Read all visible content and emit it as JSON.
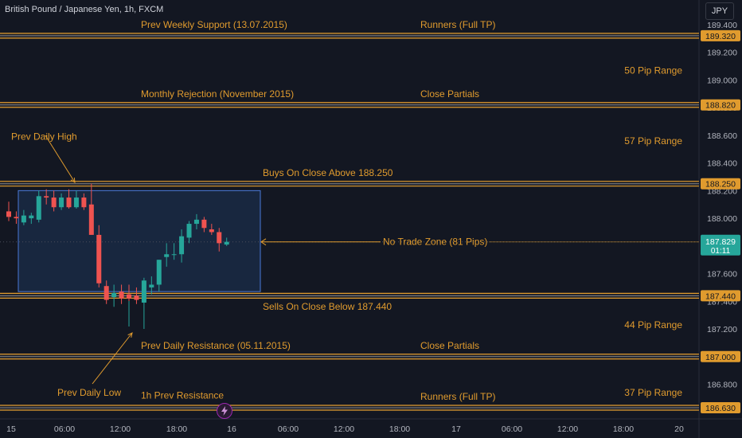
{
  "header": {
    "symbol_title": "British Pound / Japanese Yen, 1h, FXCM",
    "currency": "JPY"
  },
  "colors": {
    "background": "#131722",
    "level_line": "#e09b2e",
    "annotation_text": "#e09b2e",
    "bull": "#26a69a",
    "bear": "#ef5350",
    "zone_fill": "#1a2a44",
    "zone_border": "#2962ff",
    "axis_text": "#b2b5be"
  },
  "chart_data": {
    "type": "candlestick",
    "title": "British Pound / Japanese Yen, 1h, FXCM",
    "ylim": [
      186.55,
      189.45
    ],
    "y_ticks": [
      "186.800",
      "187.000",
      "187.200",
      "187.400",
      "187.600",
      "187.800",
      "188.000",
      "188.200",
      "188.400",
      "188.600",
      "188.800",
      "189.000",
      "189.200",
      "189.400"
    ],
    "x_ticks": [
      "15",
      "06:00",
      "12:00",
      "18:00",
      "16",
      "06:00",
      "12:00",
      "18:00",
      "17",
      "06:00",
      "12:00",
      "18:00",
      "20"
    ],
    "price_labels": [
      {
        "value": "189.320",
        "price": 189.32
      },
      {
        "value": "188.820",
        "price": 188.82
      },
      {
        "value": "188.250",
        "price": 188.25
      },
      {
        "value": "187.440",
        "price": 187.44
      },
      {
        "value": "187.000",
        "price": 187.0
      },
      {
        "value": "186.630",
        "price": 186.63
      }
    ],
    "current_price": {
      "value": "187.829",
      "countdown": "01:11",
      "price": 187.829
    },
    "levels": [
      {
        "price": 189.32
      },
      {
        "price": 188.82
      },
      {
        "price": 188.25
      },
      {
        "price": 187.44
      },
      {
        "price": 187.0
      },
      {
        "price": 186.63
      }
    ],
    "annotations": [
      {
        "text": "Prev Weekly Support (13.07.2015)",
        "price": 189.4,
        "col": "left"
      },
      {
        "text": "Runners (Full TP)",
        "price": 189.4,
        "col": "mid"
      },
      {
        "text": "50 Pip Range",
        "price": 189.07,
        "col": "right"
      },
      {
        "text": "Monthly Rejection (November 2015)",
        "price": 188.9,
        "col": "left"
      },
      {
        "text": "Close Partials",
        "price": 188.9,
        "col": "mid"
      },
      {
        "text": "Prev Daily High",
        "price": 188.59,
        "col": "far"
      },
      {
        "text": "57 Pip Range",
        "price": 188.56,
        "col": "right"
      },
      {
        "text": "Buys On Close Above 188.250",
        "price": 188.33,
        "col": "mid2"
      },
      {
        "text": "No Trade Zone (81 Pips)",
        "price": 187.83,
        "col": "nz"
      },
      {
        "text": "Sells On Close Below 187.440",
        "price": 187.36,
        "col": "mid2"
      },
      {
        "text": "44 Pip Range",
        "price": 187.23,
        "col": "right"
      },
      {
        "text": "Prev Daily Resistance (05.11.2015)",
        "price": 187.08,
        "col": "left"
      },
      {
        "text": "Close Partials",
        "price": 187.08,
        "col": "mid"
      },
      {
        "text": "Prev Daily Low",
        "price": 186.74,
        "col": "far2"
      },
      {
        "text": "37 Pip Range",
        "price": 186.74,
        "col": "right"
      },
      {
        "text": "1h Prev Resistance",
        "price": 186.72,
        "col": "left"
      },
      {
        "text": "Runners (Full TP)",
        "price": 186.71,
        "col": "mid"
      }
    ],
    "zone": {
      "label": "No Trade Zone (81 Pips)",
      "top": 188.2,
      "bottom": 187.47
    },
    "candles": [
      {
        "o": 188.05,
        "h": 188.12,
        "l": 187.98,
        "c": 188.01
      },
      {
        "o": 188.01,
        "h": 188.05,
        "l": 187.96,
        "c": 188.0
      },
      {
        "o": 187.97,
        "h": 188.06,
        "l": 187.95,
        "c": 188.02
      },
      {
        "o": 188.0,
        "h": 188.04,
        "l": 187.96,
        "c": 188.02
      },
      {
        "o": 187.99,
        "h": 188.2,
        "l": 187.97,
        "c": 188.16
      },
      {
        "o": 188.16,
        "h": 188.21,
        "l": 188.1,
        "c": 188.15
      },
      {
        "o": 188.15,
        "h": 188.2,
        "l": 188.05,
        "c": 188.08
      },
      {
        "o": 188.08,
        "h": 188.18,
        "l": 188.06,
        "c": 188.15
      },
      {
        "o": 188.15,
        "h": 188.21,
        "l": 188.07,
        "c": 188.08
      },
      {
        "o": 188.08,
        "h": 188.2,
        "l": 188.07,
        "c": 188.15
      },
      {
        "o": 188.15,
        "h": 188.18,
        "l": 188.06,
        "c": 188.08
      },
      {
        "o": 188.1,
        "h": 188.25,
        "l": 187.95,
        "c": 187.88
      },
      {
        "o": 187.88,
        "h": 187.95,
        "l": 187.5,
        "c": 187.53
      },
      {
        "o": 187.51,
        "h": 187.55,
        "l": 187.38,
        "c": 187.41
      },
      {
        "o": 187.43,
        "h": 187.52,
        "l": 187.36,
        "c": 187.46
      },
      {
        "o": 187.47,
        "h": 187.52,
        "l": 187.38,
        "c": 187.42
      },
      {
        "o": 187.45,
        "h": 187.52,
        "l": 187.4,
        "c": 187.42
      },
      {
        "o": 187.44,
        "h": 187.5,
        "l": 187.38,
        "c": 187.41
      },
      {
        "o": 187.39,
        "h": 187.57,
        "l": 187.2,
        "c": 187.55
      },
      {
        "o": 187.5,
        "h": 187.58,
        "l": 187.45,
        "c": 187.52
      },
      {
        "o": 187.52,
        "h": 187.7,
        "l": 187.47,
        "c": 187.7
      },
      {
        "o": 187.72,
        "h": 187.82,
        "l": 187.65,
        "c": 187.74
      },
      {
        "o": 187.74,
        "h": 187.82,
        "l": 187.7,
        "c": 187.74
      },
      {
        "o": 187.74,
        "h": 187.92,
        "l": 187.68,
        "c": 187.87
      },
      {
        "o": 187.86,
        "h": 187.98,
        "l": 187.82,
        "c": 187.96
      },
      {
        "o": 187.96,
        "h": 188.03,
        "l": 187.92,
        "c": 187.99
      },
      {
        "o": 187.99,
        "h": 188.01,
        "l": 187.9,
        "c": 187.93
      },
      {
        "o": 187.92,
        "h": 187.96,
        "l": 187.88,
        "c": 187.9
      },
      {
        "o": 187.9,
        "h": 187.93,
        "l": 187.76,
        "c": 187.82
      },
      {
        "o": 187.81,
        "h": 187.86,
        "l": 187.8,
        "c": 187.83
      }
    ],
    "arrows": [
      {
        "from_label": "Prev Daily High",
        "to_candle": 10,
        "to_price": 188.25
      },
      {
        "from_label": "Prev Daily Low",
        "to_candle": 19,
        "to_price": 187.2
      },
      {
        "from_label": "No Trade Zone (81 Pips)",
        "to": "zone"
      }
    ]
  }
}
